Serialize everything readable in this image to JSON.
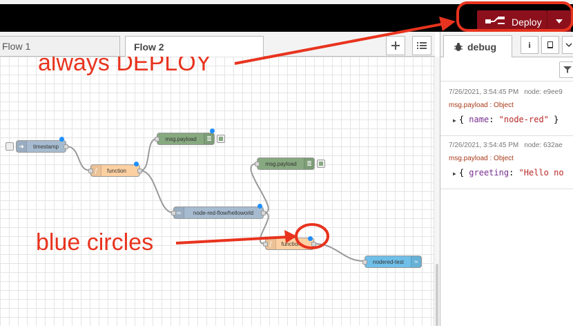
{
  "header": {
    "deploy_label": "Deploy"
  },
  "workspace": {
    "tabs": [
      {
        "label": "Flow 1",
        "active": false
      },
      {
        "label": "Flow 2",
        "active": true
      }
    ],
    "add_tab_icon": "plus-icon",
    "tab_list_icon": "list-icon"
  },
  "flow": {
    "nodes": {
      "timestamp": "timestamp",
      "function1": "function",
      "debug1": "msg.payload",
      "debug2": "msg.payload",
      "http": "node-red-flow/helloworld",
      "function2": "function",
      "mqtt": "nodered-test"
    }
  },
  "sidebar": {
    "tab_label": "debug",
    "tab_icon": "bug-icon",
    "buttons": [
      "info-icon",
      "book-icon",
      "chevron-icon"
    ],
    "filter_icon": "filter-icon",
    "messages": [
      {
        "timestamp": "7/26/2021, 3:54:45 PM",
        "node": "node: e9ee9",
        "topic": "msg.payload : Object",
        "payload_key": "name",
        "payload_value": "\"node-red\"",
        "payload_open": "{ ",
        "payload_close": " }"
      },
      {
        "timestamp": "7/26/2021, 3:54:45 PM",
        "node": "node: 632ae",
        "topic": "msg.payload : Object",
        "payload_key": "greeting",
        "payload_value": "\"Hello no",
        "payload_open": "{ ",
        "payload_close": ""
      }
    ]
  },
  "annotations": {
    "deploy_note": "always DEPLOY",
    "circles_note": "blue circles"
  },
  "colors": {
    "annotation": "#e8331e",
    "deploy": "#8c101c",
    "changed_dot": "#1e90ff"
  }
}
